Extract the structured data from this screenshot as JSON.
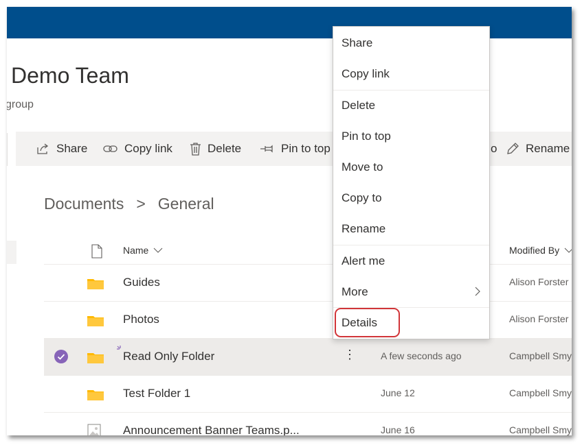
{
  "colors": {
    "suite_bar": "#004e8c",
    "accent_purple": "#8764b8",
    "folder_yellow": "#ffb900",
    "highlight_red": "#d13438"
  },
  "site": {
    "title": "Demo Team",
    "subtitle": "group"
  },
  "command_bar": {
    "items": [
      {
        "label": "Share",
        "icon": "share-icon"
      },
      {
        "label": "Copy link",
        "icon": "link-icon"
      },
      {
        "label": "Delete",
        "icon": "trash-icon"
      },
      {
        "label": "Pin to top",
        "icon": "pin-icon"
      },
      {
        "label": "o",
        "icon": ""
      },
      {
        "label": "Rename",
        "icon": "pencil-icon"
      }
    ]
  },
  "breadcrumb": {
    "root": "Documents",
    "separator": ">",
    "current": "General"
  },
  "columns": {
    "name": "Name",
    "modified_by": "Modified By"
  },
  "rows": [
    {
      "name": "Guides",
      "modified": "",
      "modified_by": "Alison Forster",
      "type": "folder",
      "selected": false
    },
    {
      "name": "Photos",
      "modified": "",
      "modified_by": "Alison Forster",
      "type": "folder",
      "selected": false
    },
    {
      "name": "Read Only Folder",
      "modified": "A few seconds ago",
      "modified_by": "Campbell Smy",
      "type": "folder",
      "selected": true
    },
    {
      "name": "Test Folder 1",
      "modified": "June 12",
      "modified_by": "Campbell Smy",
      "type": "folder",
      "selected": false
    },
    {
      "name": "Announcement Banner Teams.p...",
      "modified": "June 16",
      "modified_by": "Campbell Smy",
      "type": "image",
      "selected": false
    }
  ],
  "row_more_glyph": "⋮",
  "context_menu": {
    "items": [
      {
        "label": "Share"
      },
      {
        "label": "Copy link"
      },
      {
        "label": "Delete"
      },
      {
        "label": "Pin to top"
      },
      {
        "label": "Move to"
      },
      {
        "label": "Copy to"
      },
      {
        "label": "Rename"
      },
      {
        "label": "Alert me"
      },
      {
        "label": "More",
        "submenu": true
      },
      {
        "label": "Details",
        "highlighted": true
      }
    ]
  }
}
